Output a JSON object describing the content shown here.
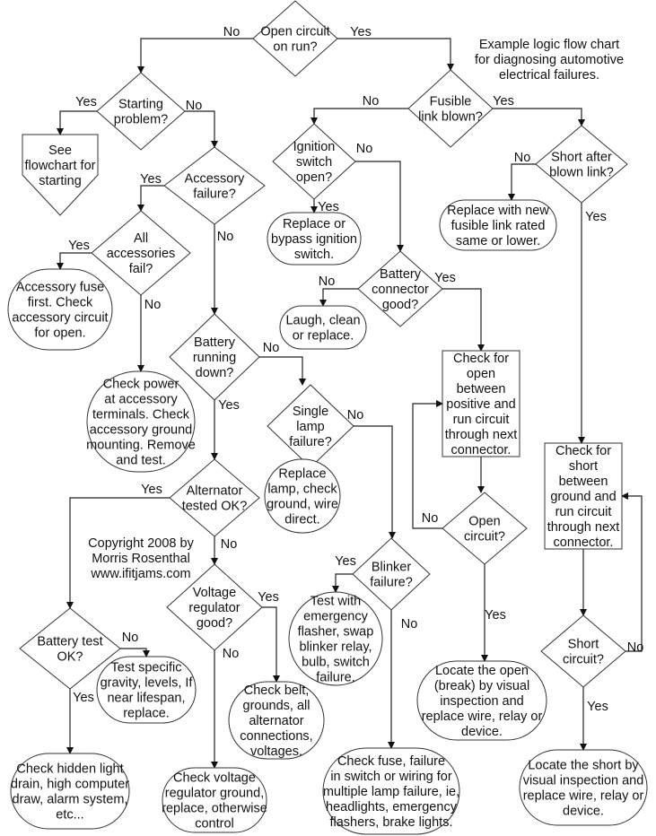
{
  "title": "Example logic flow chart for diagnosing automotive electrical failures.",
  "annotations": {
    "description": [
      "Example logic flow chart",
      "for diagnosing automotive",
      "electrical failures."
    ],
    "copyright": [
      "Copyright 2008 by",
      "Morris Rosenthal",
      "www.ifitjams.com"
    ]
  },
  "labels": {
    "yes": "Yes",
    "no": "No"
  },
  "nodes": [
    {
      "id": "open-circuit-on-run",
      "type": "decision",
      "lines": [
        "Open circuit",
        "on run?"
      ]
    },
    {
      "id": "starting-problem",
      "type": "decision",
      "lines": [
        "Starting",
        "problem?"
      ]
    },
    {
      "id": "see-flowchart-starting",
      "type": "offpage",
      "lines": [
        "See",
        "flowchart for",
        "starting"
      ]
    },
    {
      "id": "accessory-failure",
      "type": "decision",
      "lines": [
        "Accessory",
        "failure?"
      ]
    },
    {
      "id": "all-accessories-fail",
      "type": "decision",
      "lines": [
        "All",
        "accessories",
        "fail?"
      ]
    },
    {
      "id": "accessory-fuse-first",
      "type": "terminal",
      "lines": [
        "Accessory fuse",
        "first. Check",
        "accessory circuit",
        "for open."
      ]
    },
    {
      "id": "check-power-accessory",
      "type": "terminal",
      "lines": [
        "Check power",
        "at accessory",
        "terminals. Check",
        "accessory ground",
        "mounting. Remove",
        "and test."
      ]
    },
    {
      "id": "battery-running-down",
      "type": "decision",
      "lines": [
        "Battery",
        "running",
        "down?"
      ]
    },
    {
      "id": "alternator-tested-ok",
      "type": "decision",
      "lines": [
        "Alternator",
        "tested OK?"
      ]
    },
    {
      "id": "battery-test-ok",
      "type": "decision",
      "lines": [
        "Battery test",
        "OK?"
      ]
    },
    {
      "id": "test-specific-gravity",
      "type": "terminal",
      "lines": [
        "Test specific",
        "gravity, levels, If",
        "near lifespan,",
        "replace."
      ]
    },
    {
      "id": "check-hidden-light-drain",
      "type": "terminal",
      "lines": [
        "Check hidden light",
        "drain, high computer",
        "draw, alarm system,",
        "etc..."
      ]
    },
    {
      "id": "voltage-regulator-good",
      "type": "decision",
      "lines": [
        "Voltage",
        "regulator",
        "good?"
      ]
    },
    {
      "id": "check-voltage-regulator-ground",
      "type": "terminal",
      "lines": [
        "Check voltage",
        "regulator ground,",
        "replace, otherwise",
        "control"
      ]
    },
    {
      "id": "check-belt-grounds",
      "type": "terminal",
      "lines": [
        "Check belt,",
        "grounds, all",
        "alternator",
        "connections,",
        "voltages."
      ]
    },
    {
      "id": "single-lamp-failure",
      "type": "decision",
      "lines": [
        "Single",
        "lamp",
        "failure?"
      ]
    },
    {
      "id": "replace-lamp",
      "type": "terminal",
      "lines": [
        "Replace",
        "lamp, check",
        "ground, wire",
        "direct."
      ]
    },
    {
      "id": "blinker-failure",
      "type": "decision",
      "lines": [
        "Blinker",
        "failure?"
      ]
    },
    {
      "id": "test-with-emergency-flasher",
      "type": "terminal",
      "lines": [
        "Test with",
        "emergency",
        "flasher, swap",
        "blinker relay,",
        "bulb, switch",
        "failure."
      ]
    },
    {
      "id": "check-fuse-failure",
      "type": "terminal",
      "lines": [
        "Check fuse, failure",
        "in switch or wiring for",
        "multiple lamp failure, ie,",
        "headlights, emergency",
        "flashers, brake lights."
      ]
    },
    {
      "id": "fusible-link-blown",
      "type": "decision",
      "lines": [
        "Fusible",
        "link blown?"
      ]
    },
    {
      "id": "ignition-switch-open",
      "type": "decision",
      "lines": [
        "Ignition",
        "switch",
        "open?"
      ]
    },
    {
      "id": "replace-bypass-ignition",
      "type": "terminal",
      "lines": [
        "Replace or",
        "bypass ignition",
        "switch."
      ]
    },
    {
      "id": "battery-connector-good",
      "type": "decision",
      "lines": [
        "Battery",
        "connector",
        "good?"
      ]
    },
    {
      "id": "laugh-clean-replace",
      "type": "terminal",
      "lines": [
        "Laugh, clean",
        "or replace."
      ]
    },
    {
      "id": "check-for-open",
      "type": "process",
      "lines": [
        "Check for",
        "open",
        "between",
        "positive and",
        "run circuit",
        "through next",
        "connector."
      ]
    },
    {
      "id": "open-circuit",
      "type": "decision",
      "lines": [
        "Open",
        "circuit?"
      ]
    },
    {
      "id": "locate-the-open",
      "type": "terminal",
      "lines": [
        "Locate the open",
        "(break) by visual",
        "inspection and",
        "replace wire, relay or",
        "device."
      ]
    },
    {
      "id": "short-after-blown-link",
      "type": "decision",
      "lines": [
        "Short after",
        "blown link?"
      ]
    },
    {
      "id": "replace-fusible-link",
      "type": "terminal",
      "lines": [
        "Replace with new",
        "fusible link rated",
        "same or lower."
      ]
    },
    {
      "id": "check-for-short",
      "type": "process",
      "lines": [
        "Check for",
        "short",
        "between",
        "ground and",
        "run circuit",
        "through next",
        "connector."
      ]
    },
    {
      "id": "short-circuit",
      "type": "decision",
      "lines": [
        "Short",
        "circuit?"
      ]
    },
    {
      "id": "locate-the-short",
      "type": "terminal",
      "lines": [
        "Locate the short by",
        "visual inspection and",
        "replace wire, relay or",
        "device."
      ]
    }
  ],
  "edges": [
    {
      "from": "open-circuit-on-run",
      "to": "starting-problem",
      "label": "No"
    },
    {
      "from": "open-circuit-on-run",
      "to": "fusible-link-blown",
      "label": "Yes"
    },
    {
      "from": "starting-problem",
      "to": "see-flowchart-starting",
      "label": "Yes"
    },
    {
      "from": "starting-problem",
      "to": "accessory-failure",
      "label": "No"
    },
    {
      "from": "accessory-failure",
      "to": "all-accessories-fail",
      "label": "Yes"
    },
    {
      "from": "accessory-failure",
      "to": "battery-running-down",
      "label": "No"
    },
    {
      "from": "all-accessories-fail",
      "to": "accessory-fuse-first",
      "label": "Yes"
    },
    {
      "from": "all-accessories-fail",
      "to": "check-power-accessory",
      "label": "No"
    },
    {
      "from": "battery-running-down",
      "to": "alternator-tested-ok",
      "label": "Yes"
    },
    {
      "from": "battery-running-down",
      "to": "single-lamp-failure",
      "label": "No"
    },
    {
      "from": "alternator-tested-ok",
      "to": "battery-test-ok",
      "label": "Yes"
    },
    {
      "from": "alternator-tested-ok",
      "to": "voltage-regulator-good",
      "label": "No"
    },
    {
      "from": "battery-test-ok",
      "to": "check-hidden-light-drain",
      "label": "Yes"
    },
    {
      "from": "battery-test-ok",
      "to": "test-specific-gravity",
      "label": "No"
    },
    {
      "from": "voltage-regulator-good",
      "to": "check-belt-grounds",
      "label": "Yes"
    },
    {
      "from": "voltage-regulator-good",
      "to": "check-voltage-regulator-ground",
      "label": "No"
    },
    {
      "from": "single-lamp-failure",
      "to": "replace-lamp",
      "label": "Yes"
    },
    {
      "from": "single-lamp-failure",
      "to": "blinker-failure",
      "label": "No"
    },
    {
      "from": "blinker-failure",
      "to": "test-with-emergency-flasher",
      "label": "Yes"
    },
    {
      "from": "blinker-failure",
      "to": "check-fuse-failure",
      "label": "No"
    },
    {
      "from": "fusible-link-blown",
      "to": "ignition-switch-open",
      "label": "No"
    },
    {
      "from": "fusible-link-blown",
      "to": "short-after-blown-link",
      "label": "Yes"
    },
    {
      "from": "ignition-switch-open",
      "to": "replace-bypass-ignition",
      "label": "Yes"
    },
    {
      "from": "ignition-switch-open",
      "to": "battery-connector-good",
      "label": "No"
    },
    {
      "from": "battery-connector-good",
      "to": "laugh-clean-replace",
      "label": "No"
    },
    {
      "from": "battery-connector-good",
      "to": "check-for-open",
      "label": "Yes"
    },
    {
      "from": "check-for-open",
      "to": "open-circuit",
      "label": ""
    },
    {
      "from": "open-circuit",
      "to": "check-for-open",
      "label": "No"
    },
    {
      "from": "open-circuit",
      "to": "locate-the-open",
      "label": "Yes"
    },
    {
      "from": "short-after-blown-link",
      "to": "replace-fusible-link",
      "label": "No"
    },
    {
      "from": "short-after-blown-link",
      "to": "check-for-short",
      "label": "Yes"
    },
    {
      "from": "check-for-short",
      "to": "short-circuit",
      "label": ""
    },
    {
      "from": "short-circuit",
      "to": "check-for-short",
      "label": "No"
    },
    {
      "from": "short-circuit",
      "to": "locate-the-short",
      "label": "Yes"
    }
  ]
}
